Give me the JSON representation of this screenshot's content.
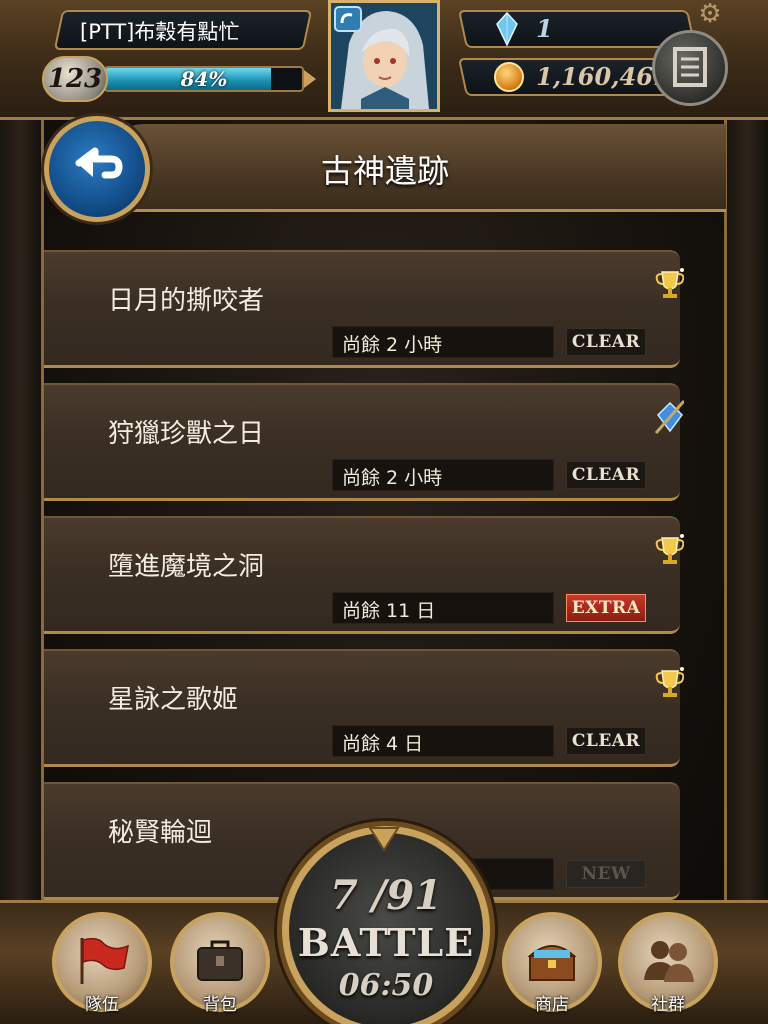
{
  "player": {
    "name": "[PTT]布穀有點忙",
    "level": "123",
    "exp_percent_label": "84%",
    "exp_fraction": 0.84
  },
  "currency": {
    "gems": "1",
    "coins": "1,160,461"
  },
  "screen": {
    "title": "古神遺跡"
  },
  "stages": [
    {
      "name": "日月的撕咬者",
      "time_left": "尚餘 2 小時",
      "badge": "CLEAR",
      "badge_type": "clear",
      "icon": "trophy-icon"
    },
    {
      "name": "狩獵珍獸之日",
      "time_left": "尚餘 2 小時",
      "badge": "CLEAR",
      "badge_type": "clear",
      "icon": "blue-gem-sword-icon"
    },
    {
      "name": "墮進魔境之洞",
      "time_left": "尚餘 11 日",
      "badge": "EXTRA",
      "badge_type": "extra",
      "icon": "trophy-icon"
    },
    {
      "name": "星詠之歌姬",
      "time_left": "尚餘 4 日",
      "badge": "CLEAR",
      "badge_type": "clear",
      "icon": "trophy-icon"
    },
    {
      "name": "秘賢輪迴",
      "time_left": "",
      "badge": "NEW",
      "badge_type": "new",
      "icon": ""
    }
  ],
  "nav": {
    "team": "隊伍",
    "bag": "背包",
    "shop": "商店",
    "social": "社群"
  },
  "battle": {
    "stamina": "7 /91",
    "label": "BATTLE",
    "timer": "06:50"
  },
  "colors": {
    "accent_gold": "#c9a35e",
    "exp_bar": "#1a8fb2",
    "extra_badge": "#c63a2a"
  }
}
